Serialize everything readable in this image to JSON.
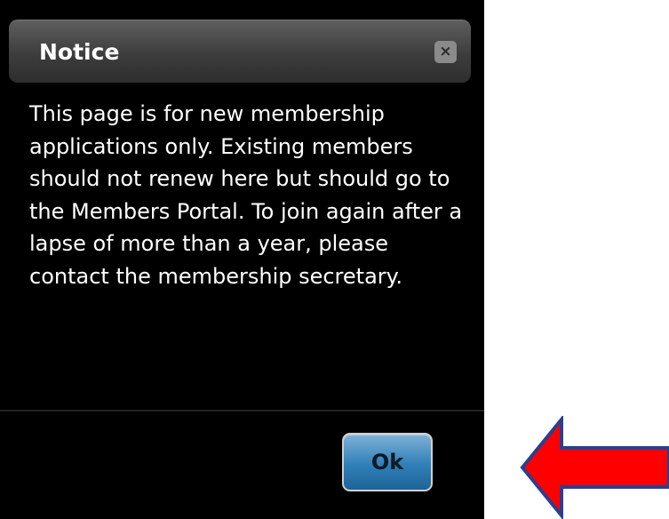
{
  "dialog": {
    "title": "Notice",
    "close_icon": "close-icon",
    "close_glyph": "×",
    "message": "This page is for new membership applications only. Existing members should not renew here but should go to the Members Portal. To join again after a lapse of more than a year, please contact the membership secretary.",
    "ok_label": "Ok"
  },
  "annotation": {
    "arrow_icon": "left-arrow-icon",
    "arrow_color": "#ff0000",
    "arrow_outline": "#2b3f8f"
  },
  "colors": {
    "dialog_background": "#000000",
    "ok_button": "#2f7fb8"
  }
}
